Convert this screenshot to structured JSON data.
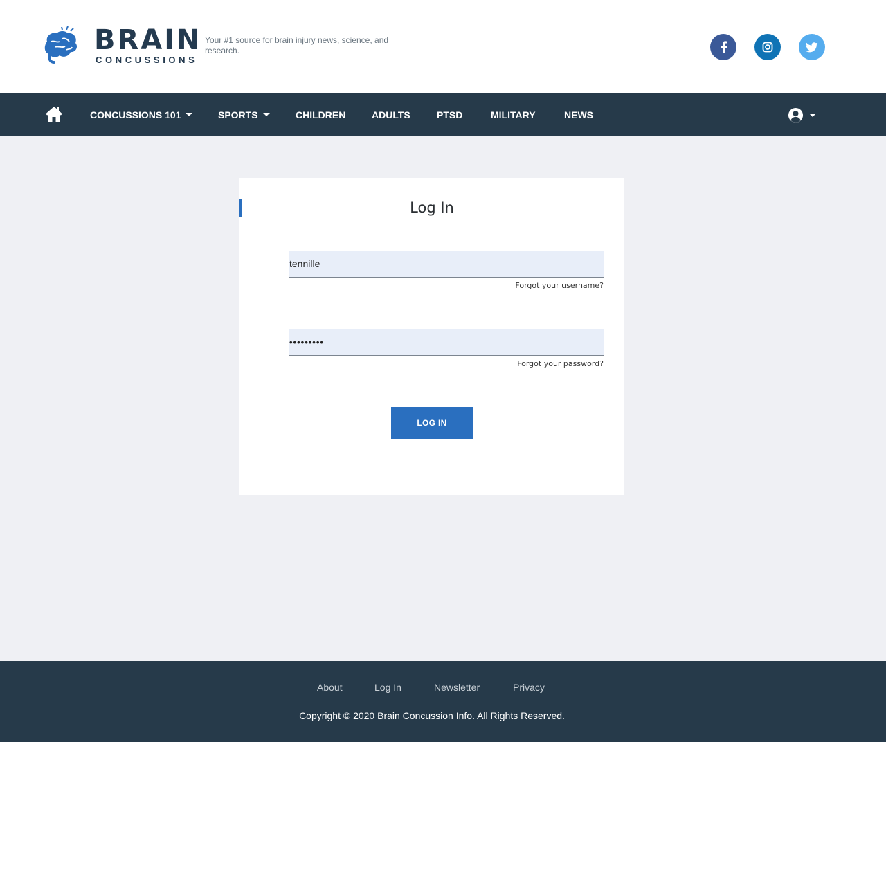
{
  "header": {
    "brand": "BRAIN",
    "brand_sub": "CONCUSSIONS",
    "tagline": "Your #1 source for brain injury news, science, and research."
  },
  "social": {
    "facebook_icon": "facebook-icon",
    "instagram_icon": "instagram-icon",
    "twitter_icon": "twitter-icon",
    "colors": {
      "facebook": "#3b5998",
      "instagram": "#0f73b5",
      "twitter": "#55acee"
    }
  },
  "nav": {
    "items": [
      {
        "label": "CONCUSSIONS 101",
        "dropdown": true
      },
      {
        "label": "SPORTS",
        "dropdown": true
      },
      {
        "label": "CHILDREN"
      },
      {
        "label": "ADULTS"
      },
      {
        "label": "PTSD"
      },
      {
        "label": "MILITARY"
      },
      {
        "label": "NEWS"
      }
    ],
    "home_icon": "home-icon",
    "user_icon": "user-circle-icon"
  },
  "login": {
    "title": "Log In",
    "username_value": "tennille",
    "password_value": "•••••••••",
    "forgot_username": "Forgot your username?",
    "forgot_password": "Forgot your password?",
    "button": "LOG IN"
  },
  "footer": {
    "links": [
      "About",
      "Log In",
      "Newsletter",
      "Privacy"
    ],
    "copyright": "Copyright © 2020 Brain Concussion Info. All Rights Reserved."
  },
  "colors": {
    "nav_bg": "#263a4a",
    "accent": "#2a6fbf",
    "page_bg": "#eff0f4"
  }
}
